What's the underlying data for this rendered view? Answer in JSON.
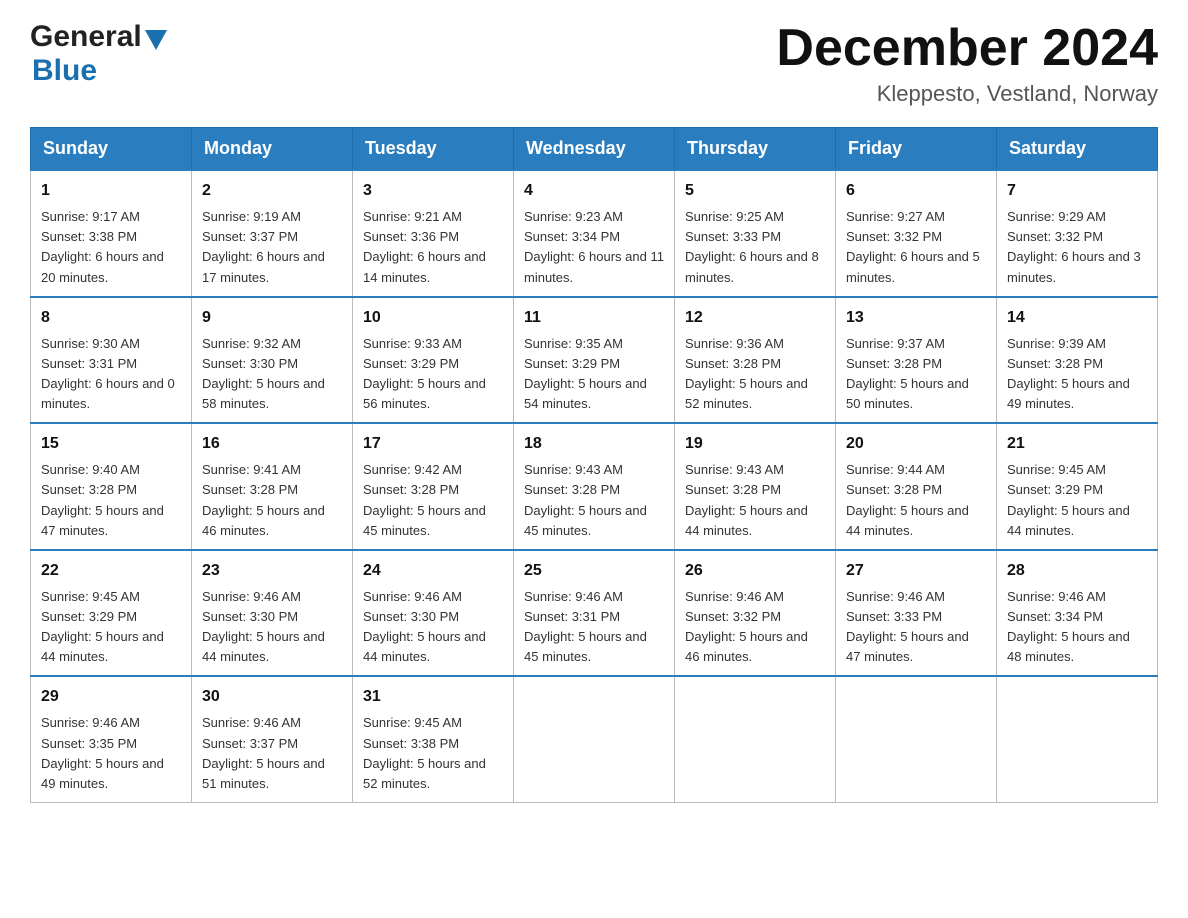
{
  "header": {
    "logo_general": "General",
    "logo_blue": "Blue",
    "month_title": "December 2024",
    "location": "Kleppesto, Vestland, Norway"
  },
  "weekdays": [
    "Sunday",
    "Monday",
    "Tuesday",
    "Wednesday",
    "Thursday",
    "Friday",
    "Saturday"
  ],
  "weeks": [
    [
      {
        "day": "1",
        "sunrise": "9:17 AM",
        "sunset": "3:38 PM",
        "daylight": "6 hours and 20 minutes."
      },
      {
        "day": "2",
        "sunrise": "9:19 AM",
        "sunset": "3:37 PM",
        "daylight": "6 hours and 17 minutes."
      },
      {
        "day": "3",
        "sunrise": "9:21 AM",
        "sunset": "3:36 PM",
        "daylight": "6 hours and 14 minutes."
      },
      {
        "day": "4",
        "sunrise": "9:23 AM",
        "sunset": "3:34 PM",
        "daylight": "6 hours and 11 minutes."
      },
      {
        "day": "5",
        "sunrise": "9:25 AM",
        "sunset": "3:33 PM",
        "daylight": "6 hours and 8 minutes."
      },
      {
        "day": "6",
        "sunrise": "9:27 AM",
        "sunset": "3:32 PM",
        "daylight": "6 hours and 5 minutes."
      },
      {
        "day": "7",
        "sunrise": "9:29 AM",
        "sunset": "3:32 PM",
        "daylight": "6 hours and 3 minutes."
      }
    ],
    [
      {
        "day": "8",
        "sunrise": "9:30 AM",
        "sunset": "3:31 PM",
        "daylight": "6 hours and 0 minutes."
      },
      {
        "day": "9",
        "sunrise": "9:32 AM",
        "sunset": "3:30 PM",
        "daylight": "5 hours and 58 minutes."
      },
      {
        "day": "10",
        "sunrise": "9:33 AM",
        "sunset": "3:29 PM",
        "daylight": "5 hours and 56 minutes."
      },
      {
        "day": "11",
        "sunrise": "9:35 AM",
        "sunset": "3:29 PM",
        "daylight": "5 hours and 54 minutes."
      },
      {
        "day": "12",
        "sunrise": "9:36 AM",
        "sunset": "3:28 PM",
        "daylight": "5 hours and 52 minutes."
      },
      {
        "day": "13",
        "sunrise": "9:37 AM",
        "sunset": "3:28 PM",
        "daylight": "5 hours and 50 minutes."
      },
      {
        "day": "14",
        "sunrise": "9:39 AM",
        "sunset": "3:28 PM",
        "daylight": "5 hours and 49 minutes."
      }
    ],
    [
      {
        "day": "15",
        "sunrise": "9:40 AM",
        "sunset": "3:28 PM",
        "daylight": "5 hours and 47 minutes."
      },
      {
        "day": "16",
        "sunrise": "9:41 AM",
        "sunset": "3:28 PM",
        "daylight": "5 hours and 46 minutes."
      },
      {
        "day": "17",
        "sunrise": "9:42 AM",
        "sunset": "3:28 PM",
        "daylight": "5 hours and 45 minutes."
      },
      {
        "day": "18",
        "sunrise": "9:43 AM",
        "sunset": "3:28 PM",
        "daylight": "5 hours and 45 minutes."
      },
      {
        "day": "19",
        "sunrise": "9:43 AM",
        "sunset": "3:28 PM",
        "daylight": "5 hours and 44 minutes."
      },
      {
        "day": "20",
        "sunrise": "9:44 AM",
        "sunset": "3:28 PM",
        "daylight": "5 hours and 44 minutes."
      },
      {
        "day": "21",
        "sunrise": "9:45 AM",
        "sunset": "3:29 PM",
        "daylight": "5 hours and 44 minutes."
      }
    ],
    [
      {
        "day": "22",
        "sunrise": "9:45 AM",
        "sunset": "3:29 PM",
        "daylight": "5 hours and 44 minutes."
      },
      {
        "day": "23",
        "sunrise": "9:46 AM",
        "sunset": "3:30 PM",
        "daylight": "5 hours and 44 minutes."
      },
      {
        "day": "24",
        "sunrise": "9:46 AM",
        "sunset": "3:30 PM",
        "daylight": "5 hours and 44 minutes."
      },
      {
        "day": "25",
        "sunrise": "9:46 AM",
        "sunset": "3:31 PM",
        "daylight": "5 hours and 45 minutes."
      },
      {
        "day": "26",
        "sunrise": "9:46 AM",
        "sunset": "3:32 PM",
        "daylight": "5 hours and 46 minutes."
      },
      {
        "day": "27",
        "sunrise": "9:46 AM",
        "sunset": "3:33 PM",
        "daylight": "5 hours and 47 minutes."
      },
      {
        "day": "28",
        "sunrise": "9:46 AM",
        "sunset": "3:34 PM",
        "daylight": "5 hours and 48 minutes."
      }
    ],
    [
      {
        "day": "29",
        "sunrise": "9:46 AM",
        "sunset": "3:35 PM",
        "daylight": "5 hours and 49 minutes."
      },
      {
        "day": "30",
        "sunrise": "9:46 AM",
        "sunset": "3:37 PM",
        "daylight": "5 hours and 51 minutes."
      },
      {
        "day": "31",
        "sunrise": "9:45 AM",
        "sunset": "3:38 PM",
        "daylight": "5 hours and 52 minutes."
      },
      null,
      null,
      null,
      null
    ]
  ]
}
